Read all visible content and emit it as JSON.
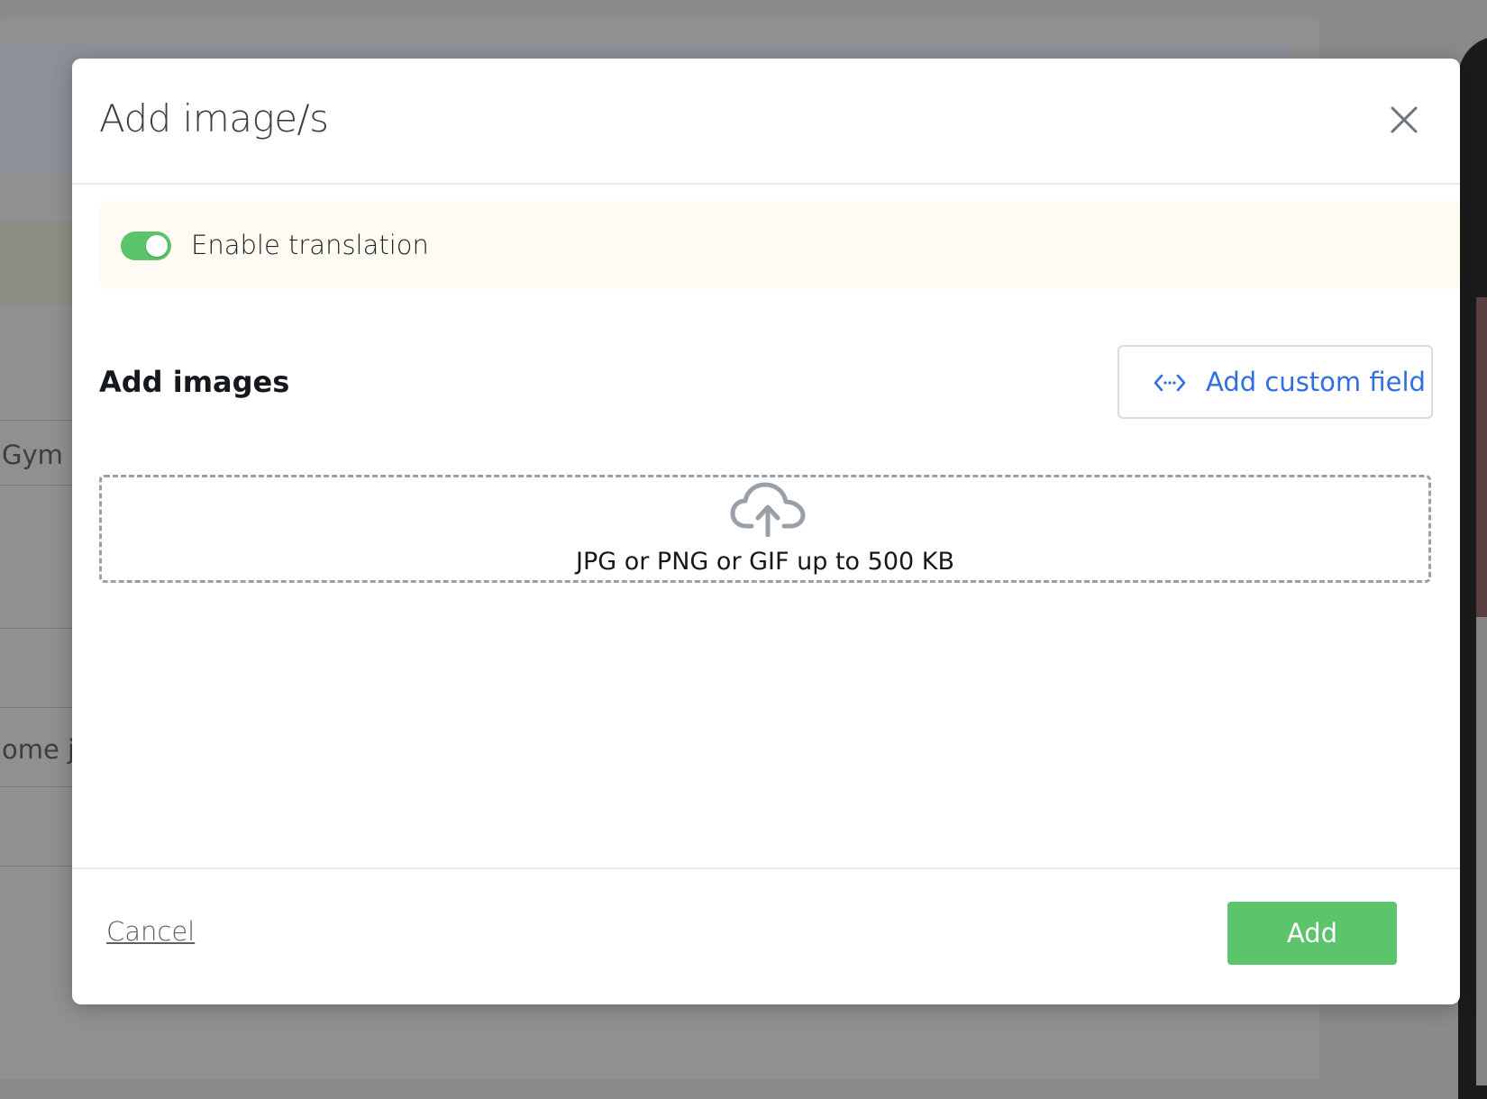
{
  "background": {
    "row_text_1": "Gym",
    "row_text_2": "ome jo"
  },
  "modal": {
    "title": "Add image/s",
    "close_icon": "close-icon",
    "translation": {
      "label": "Enable translation",
      "enabled": true
    },
    "section_title": "Add images",
    "custom_field_button": {
      "label": "Add custom field",
      "icon": "code-icon"
    },
    "dropzone": {
      "icon": "cloud-upload-icon",
      "hint": "JPG or PNG or GIF up to 500 KB"
    },
    "footer": {
      "cancel_label": "Cancel",
      "add_label": "Add"
    }
  },
  "colors": {
    "accent_green": "#5cc46a",
    "link_blue": "#2f6fe0",
    "translation_bg": "#fefcf2"
  }
}
